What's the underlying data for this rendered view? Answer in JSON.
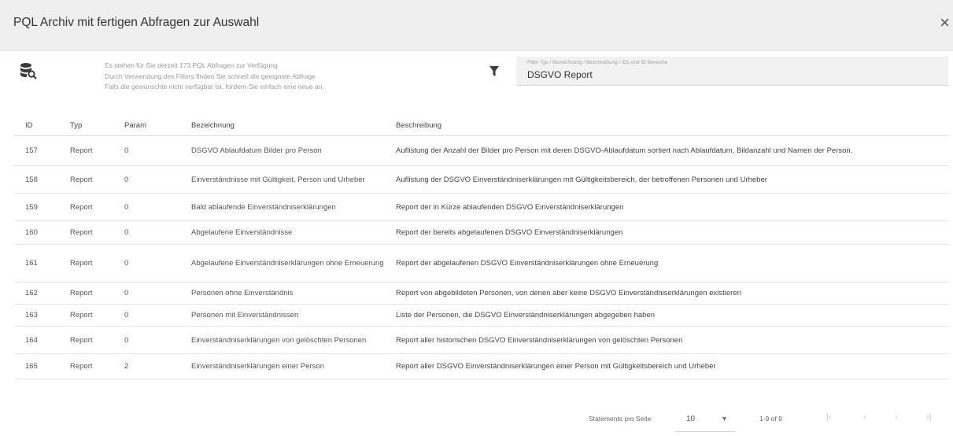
{
  "dialog": {
    "title": "PQL Archiv mit fertigen Abfragen zur Auswahl",
    "close_glyph": "×"
  },
  "info": {
    "line1": "Es stehen für Sie derzeit 173 PQL Abfragen zur Verfügung",
    "line2": "Durch Verwendung des Filters finden Sie schnell die geeignete Abfrage",
    "line3": "Falls die gewünschte nicht verfügbar ist, fordern Sie einfach eine neue an."
  },
  "filter": {
    "label": "Filter Typ / Bezeichnung / Beschreibung / IDs und ID Bereiche",
    "value": "DSGVO Report"
  },
  "table": {
    "headers": {
      "id": "ID",
      "typ": "Typ",
      "param": "Param",
      "bez": "Bezeichnung",
      "desc": "Beschreibung"
    },
    "rows": [
      {
        "id": "157",
        "typ": "Report",
        "param": "0",
        "bez": "DSGVO Ablaufdatum Bilder pro Person",
        "desc": "Auflistung der Anzahl der Bilder pro Person mit deren DSGVO-Ablaufdatum sortiert nach Ablaufdatum, Bildanzahl und Namen der Person."
      },
      {
        "id": "158",
        "typ": "Report",
        "param": "0",
        "bez": "Einverständnisse mit Gültigkeit, Person und Urheber",
        "desc": "Auflistung der DSGVO Einverständniserklärungen mit Gültigkeitsbereich, der betroffenen Personen und Urheber"
      },
      {
        "id": "159",
        "typ": "Report",
        "param": "0",
        "bez": "Bald ablaufende Einverständniserklärungen",
        "desc": "Report der in Kürze ablaufenden DSGVO Einverständniserklärungen"
      },
      {
        "id": "160",
        "typ": "Report",
        "param": "0",
        "bez": "Abgelaufene Einverständnisse",
        "desc": "Report der bereits abgelaufenen DSGVO Einverständniserklärungen"
      },
      {
        "id": "161",
        "typ": "Report",
        "param": "0",
        "bez": "Abgelaufene Einverständniserklärungen ohne Erneuerung",
        "desc": "Report der abgelaufenen DSGVO Einverständniserklärungen ohne Erneuerung"
      },
      {
        "id": "162",
        "typ": "Report",
        "param": "0",
        "bez": "Personen ohne Einverständnis",
        "desc": "Report von abgebildeten Personen, von denen aber keine DSGVO Einverständniserklärungen existieren"
      },
      {
        "id": "163",
        "typ": "Report",
        "param": "0",
        "bez": "Personen mit Einverständnissen",
        "desc": "Liste der Personen, die DSGVO Einverständniserklärungen abgegeben haben"
      },
      {
        "id": "164",
        "typ": "Report",
        "param": "0",
        "bez": "Einverständniserklärungen von gelöschten Personen",
        "desc": "Report aller historischen DSGVO Einverständniserklärungen von gelöschten Personen"
      },
      {
        "id": "165",
        "typ": "Report",
        "param": "2",
        "bez": "Einverständniserklärungen einer Person",
        "desc": "Report aller DSGVO Einverständniserklärungen einer Person mit Gültigkeitsbereich und Urheber"
      }
    ]
  },
  "paginator": {
    "per_page_label": "Statements pro Seite",
    "per_page_value": "10",
    "range": "1-9 of 9",
    "first": "|‹",
    "prev": "‹",
    "next": "›",
    "last": "›|"
  },
  "icons": {
    "db": "database-search-icon",
    "filter": "filter-icon",
    "close": "close-icon",
    "dropdown": "chevron-down-icon"
  },
  "colors": {
    "header_bg": "#efefef",
    "filter_bg": "#f2f2f2",
    "icon": "#3a3a3a"
  }
}
